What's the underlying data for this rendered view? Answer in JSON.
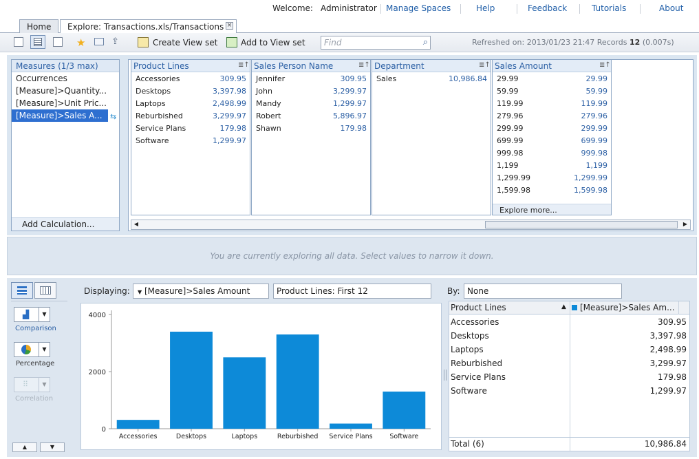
{
  "topnav": {
    "welcome_label": "Welcome:",
    "user": "Administrator",
    "links": [
      "Manage Spaces",
      "Help",
      "Feedback",
      "Tutorials",
      "About"
    ]
  },
  "tabs": {
    "home": "Home",
    "active": "Explore: Transactions.xls/Transactions"
  },
  "toolbar": {
    "create_view_set": "Create View set",
    "add_to_view_set": "Add to View set",
    "find_placeholder": "Find",
    "refreshed_label": "Refreshed on: 2013/01/23 21:47 Records",
    "records": "12",
    "time": "(0.007s)"
  },
  "measures": {
    "header": "Measures (1/3 max)",
    "items": [
      "Occurrences",
      "[Measure]>Quantity...",
      "[Measure]>Unit Pric...",
      "[Measure]>Sales A..."
    ],
    "add_calculation": "Add Calculation..."
  },
  "columns": {
    "product_lines": {
      "header": "Product Lines",
      "rows": [
        {
          "k": "Accessories",
          "v": "309.95"
        },
        {
          "k": "Desktops",
          "v": "3,397.98"
        },
        {
          "k": "Laptops",
          "v": "2,498.99"
        },
        {
          "k": "Reburbished",
          "v": "3,299.97"
        },
        {
          "k": "Service Plans",
          "v": "179.98"
        },
        {
          "k": "Software",
          "v": "1,299.97"
        }
      ]
    },
    "sales_person": {
      "header": "Sales Person Name",
      "rows": [
        {
          "k": "Jennifer",
          "v": "309.95"
        },
        {
          "k": "John",
          "v": "3,299.97"
        },
        {
          "k": "Mandy",
          "v": "1,299.97"
        },
        {
          "k": "Robert",
          "v": "5,896.97"
        },
        {
          "k": "Shawn",
          "v": "179.98"
        }
      ]
    },
    "department": {
      "header": "Department",
      "rows": [
        {
          "k": "Sales",
          "v": "10,986.84"
        }
      ]
    },
    "sales_amount": {
      "header": "Sales Amount",
      "rows": [
        {
          "k": "29.99",
          "v": "29.99"
        },
        {
          "k": "59.99",
          "v": "59.99"
        },
        {
          "k": "119.99",
          "v": "119.99"
        },
        {
          "k": "279.96",
          "v": "279.96"
        },
        {
          "k": "299.99",
          "v": "299.99"
        },
        {
          "k": "699.99",
          "v": "699.99"
        },
        {
          "k": "999.98",
          "v": "999.98"
        },
        {
          "k": "1,199",
          "v": "1,199"
        },
        {
          "k": "1,299.99",
          "v": "1,299.99"
        },
        {
          "k": "1,599.98",
          "v": "1,599.98"
        }
      ],
      "explore_more": "Explore more..."
    }
  },
  "message": "You are currently exploring all data. Select values to narrow it down.",
  "chart_panel": {
    "displaying_label": "Displaying:",
    "measure_select": "[Measure]>Sales Amount",
    "dimension_select": "Product Lines: First 12",
    "by_label": "By:",
    "by_select": "None",
    "types": [
      "Comparison",
      "Percentage",
      "Correlation"
    ]
  },
  "chart_data": {
    "type": "bar",
    "categories": [
      "Accessories",
      "Desktops",
      "Laptops",
      "Reburbished",
      "Service Plans",
      "Software"
    ],
    "values": [
      309.95,
      3397.98,
      2498.99,
      3299.97,
      179.98,
      1299.97
    ],
    "ylim": [
      0,
      4000
    ],
    "yticks": [
      0,
      2000,
      4000
    ],
    "bar_color": "#0d8ad8",
    "grid": false
  },
  "table": {
    "col1": "Product Lines",
    "col2": "[Measure]>Sales Am...",
    "rows": [
      {
        "k": "Accessories",
        "v": "309.95"
      },
      {
        "k": "Desktops",
        "v": "3,397.98"
      },
      {
        "k": "Laptops",
        "v": "2,498.99"
      },
      {
        "k": "Reburbished",
        "v": "3,299.97"
      },
      {
        "k": "Service Plans",
        "v": "179.98"
      },
      {
        "k": "Software",
        "v": "1,299.97"
      }
    ],
    "total_label": "Total (6)",
    "total_value": "10,986.84"
  }
}
